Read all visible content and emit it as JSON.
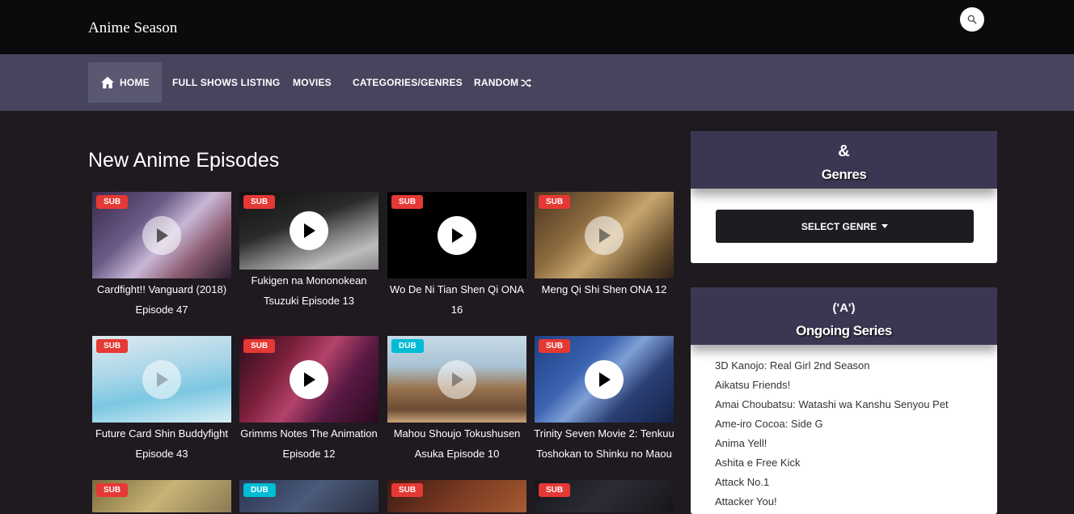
{
  "site": {
    "logo": "Anime Season"
  },
  "nav": {
    "home": "HOME",
    "full_shows": "FULL SHOWS LISTING",
    "movies": "MOVIES",
    "categories": "CATEGORIES/GENRES",
    "random": "RANDOM"
  },
  "main": {
    "title": "New Anime Episodes"
  },
  "episodes": [
    {
      "badge": "SUB",
      "line1": "Cardfight!! Vanguard (2018)",
      "line2": "Episode 47"
    },
    {
      "badge": "SUB",
      "line1": "Fukigen na Mononokean",
      "line2": "Tsuzuki Episode 13"
    },
    {
      "badge": "SUB",
      "line1": "Wo De Ni Tian Shen Qi ONA",
      "line2": "16"
    },
    {
      "badge": "SUB",
      "line1": "Meng Qi Shi Shen ONA 12",
      "line2": ""
    },
    {
      "badge": "SUB",
      "line1": "Future Card Shin Buddyfight",
      "line2": "Episode 43"
    },
    {
      "badge": "SUB",
      "line1": "Grimms Notes The Animation",
      "line2": "Episode 12"
    },
    {
      "badge": "DUB",
      "line1": "Mahou Shoujo Tokushusen",
      "line2": "Asuka Episode 10"
    },
    {
      "badge": "SUB",
      "line1": "Trinity Seven Movie 2: Tenkuu",
      "line2": "Toshokan to Shinku no Maou"
    },
    {
      "badge": "SUB",
      "line1": "",
      "line2": ""
    },
    {
      "badge": "DUB",
      "line1": "",
      "line2": ""
    },
    {
      "badge": "SUB",
      "line1": "",
      "line2": ""
    },
    {
      "badge": "SUB",
      "line1": "",
      "line2": ""
    }
  ],
  "sidebar": {
    "genres": {
      "icon": "&",
      "title": "Genres",
      "select_label": "SELECT GENRE"
    },
    "ongoing": {
      "icon": "('A')",
      "title": "Ongoing Series",
      "items": [
        "3D Kanojo: Real Girl 2nd Season",
        "Aikatsu Friends!",
        "Amai Choubatsu: Watashi wa Kanshu Senyou Pet",
        "Ame-iro Cocoa: Side G",
        "Anima Yell!",
        "Ashita e Free Kick",
        "Attack No.1",
        "Attacker You!"
      ]
    }
  },
  "colors": {
    "topbar": "#0b0a0c",
    "navbar": "#47445d",
    "page_bg": "#1e1a20",
    "sub_badge": "#e53935",
    "dub_badge": "#00bcd4",
    "widget_head": "#3b3752"
  }
}
